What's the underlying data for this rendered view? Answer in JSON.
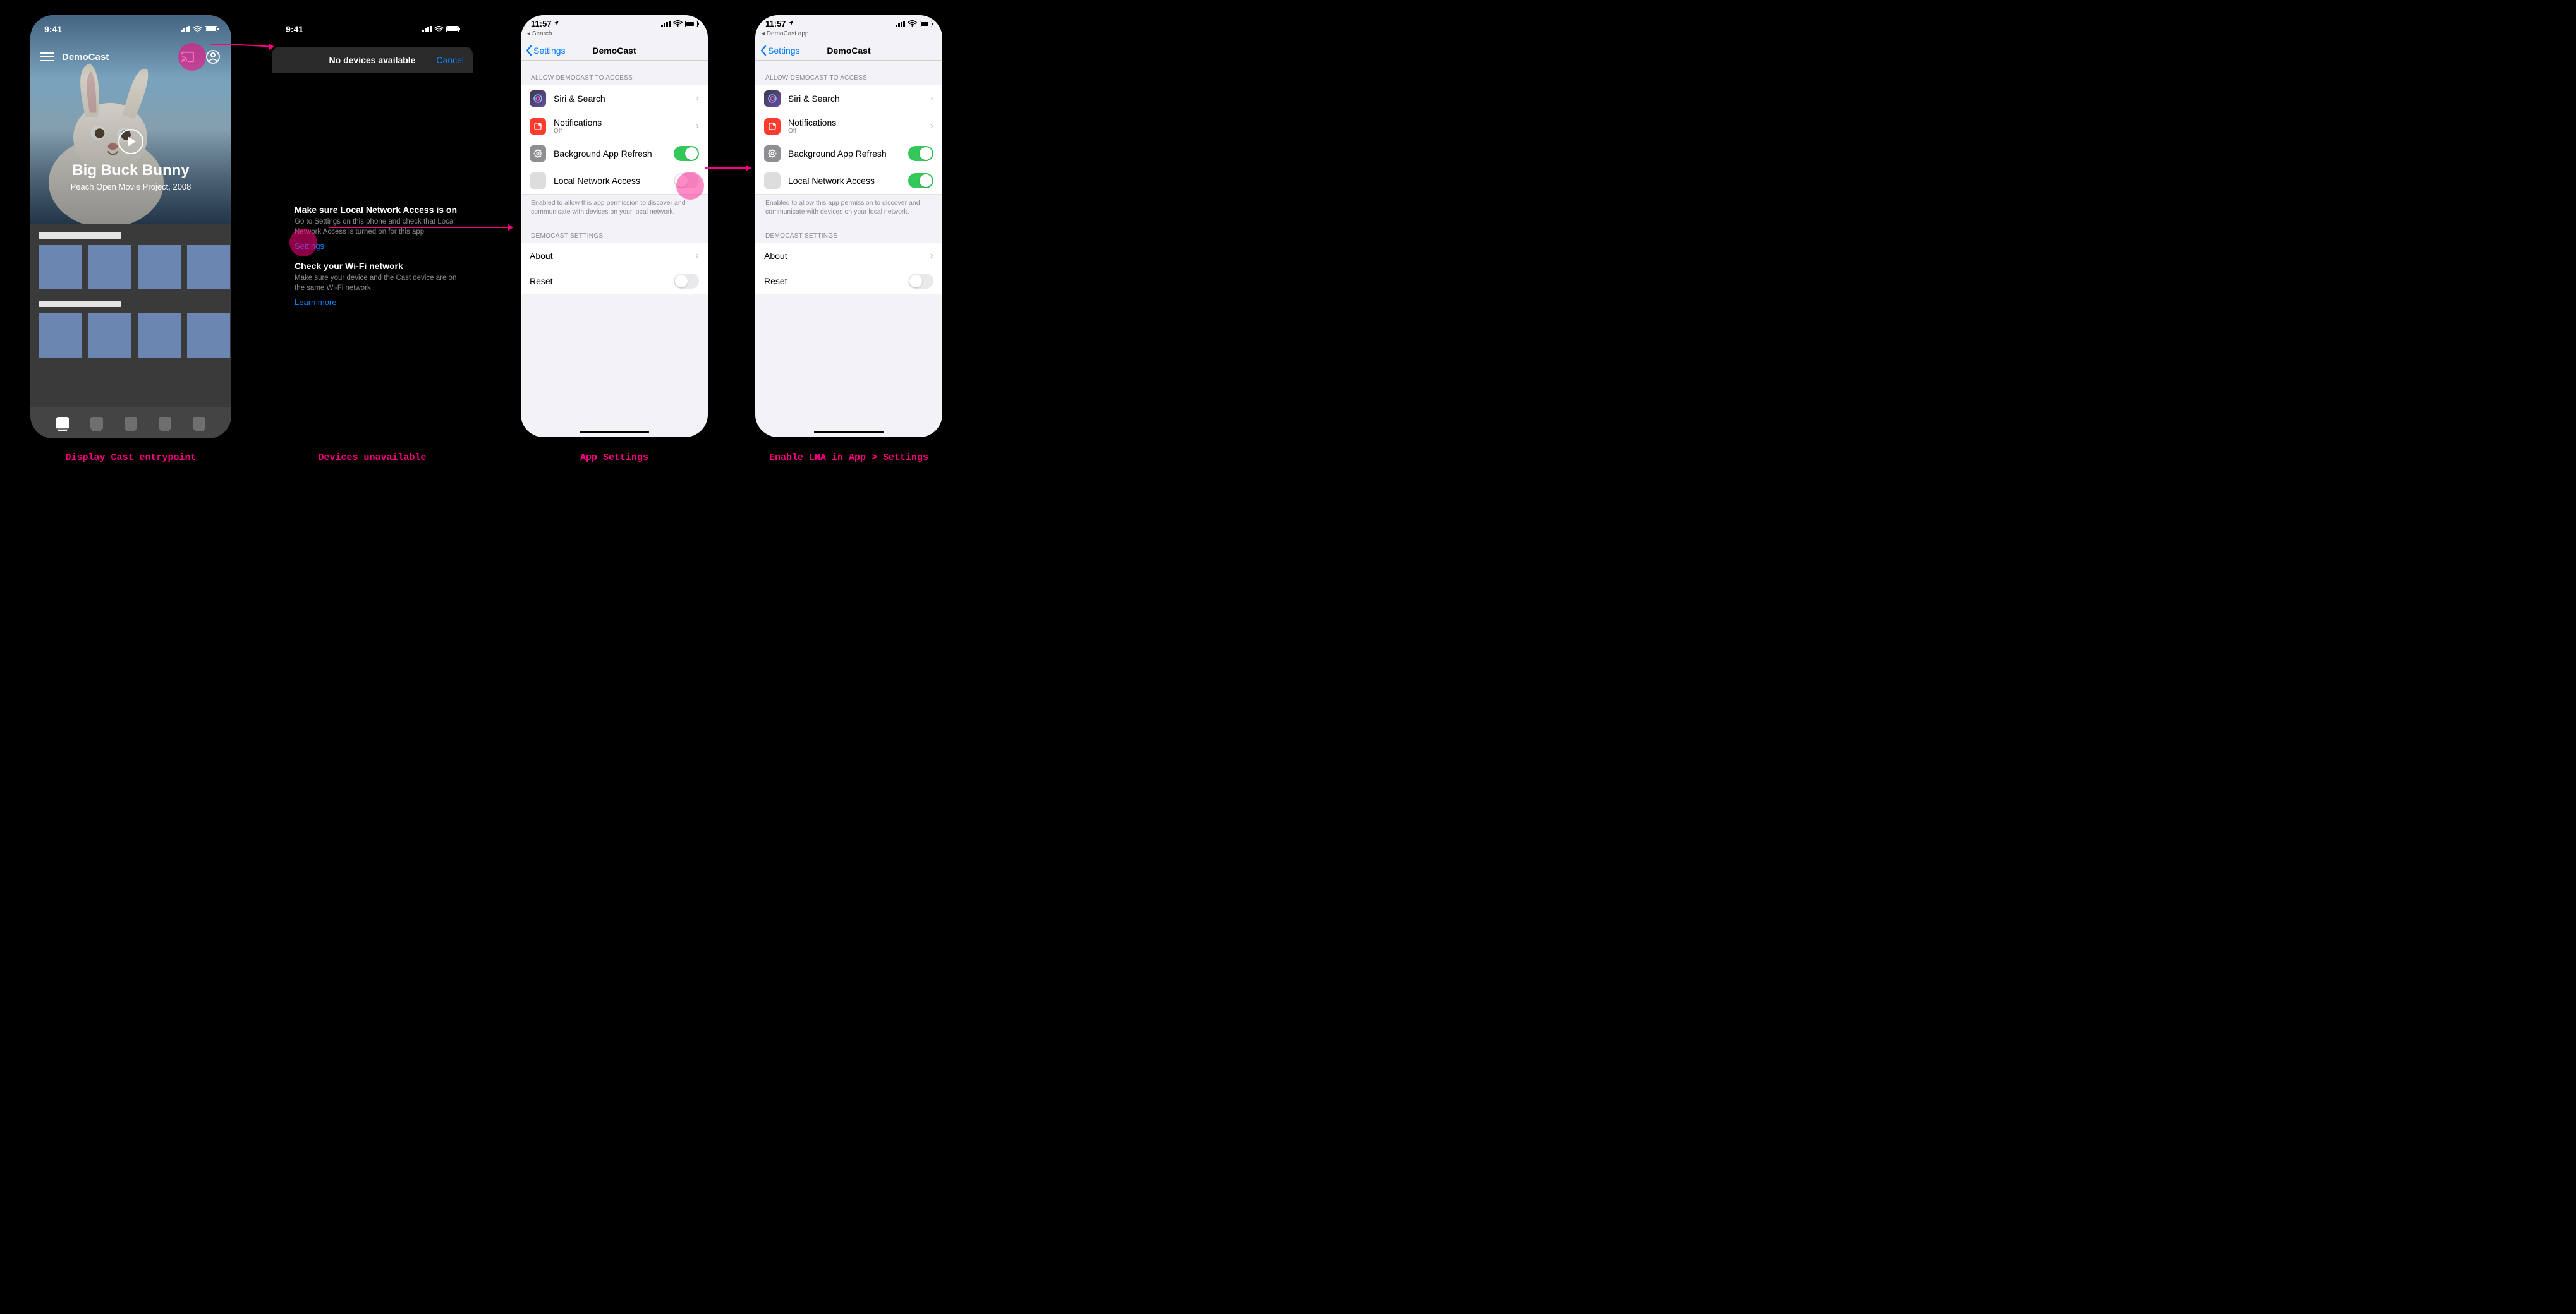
{
  "captions": {
    "c1": "Display Cast entrypoint",
    "c2": "Devices unavailable",
    "c3": "App Settings",
    "c4": "Enable LNA in App > Settings"
  },
  "screen1": {
    "time": "9:41",
    "brand": "DemoCast",
    "video_title": "Big Buck Bunny",
    "video_subtitle": "Peach Open Movie Project, 2008"
  },
  "screen2": {
    "time": "9:41",
    "sheet_title": "No devices available",
    "cancel": "Cancel",
    "tip1_title": "Make sure Local Network Access is on",
    "tip1_body": "Go to Settings on this phone and check that Local Network Access is turned on for this app",
    "tip1_link": "Settings",
    "tip2_title": "Check your Wi-Fi network",
    "tip2_body": "Make sure your device and the Cast device are on the same Wi-Fi network",
    "tip2_link": "Learn more"
  },
  "ios_common": {
    "time": "11:57",
    "back": "Settings",
    "title": "DemoCast",
    "section_access": "ALLOW DEMOCAST TO ACCESS",
    "row_siri": "Siri & Search",
    "row_notif": "Notifications",
    "row_notif_sub": "Off",
    "row_bg": "Background App Refresh",
    "row_lna": "Local Network Access",
    "lna_footer": "Enabled to allow this app permission to discover and communicate with devices on your local network.",
    "section_app": "DEMOCAST SETTINGS",
    "row_about": "About",
    "row_reset": "Reset"
  },
  "screen3": {
    "breadcrumb": "◂ Search",
    "lna_on": false
  },
  "screen4": {
    "breadcrumb": "◂ DemoCast app",
    "lna_on": true
  }
}
